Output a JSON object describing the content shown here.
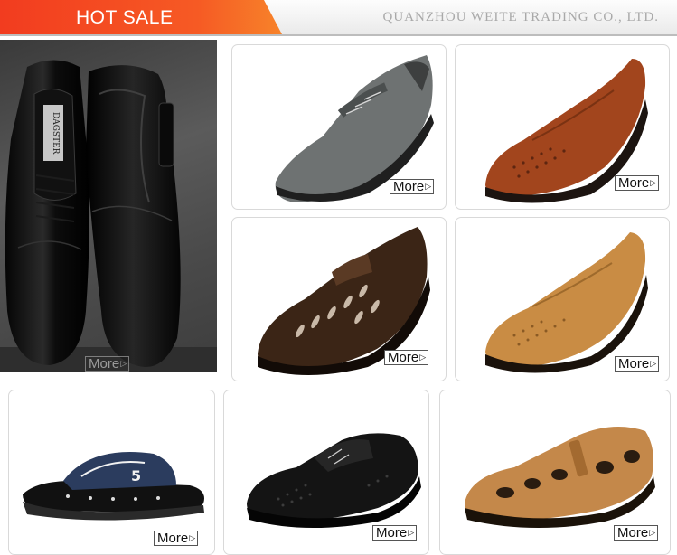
{
  "header": {
    "hot_sale": "HOT SALE",
    "company": "QUANZHOU WEITE TRADING CO., LTD."
  },
  "feature": {
    "brand": "DAGSTER",
    "more_label": "More"
  },
  "products": [
    {
      "name": "gray-lace-up-loafer",
      "more_label": "More"
    },
    {
      "name": "brown-perforated-loafer",
      "more_label": "More"
    },
    {
      "name": "dark-brown-hollow-loafer",
      "more_label": "More"
    },
    {
      "name": "tan-perforated-loafer",
      "more_label": "More"
    },
    {
      "name": "black-sport-slide",
      "more_label": "More"
    },
    {
      "name": "black-perforated-lace-up",
      "more_label": "More"
    },
    {
      "name": "tan-hollow-sandal",
      "more_label": "More"
    }
  ],
  "colors": {
    "banner": "#f23c1f",
    "company_text": "#a9a9a9",
    "card_border": "#d9d9d9"
  }
}
